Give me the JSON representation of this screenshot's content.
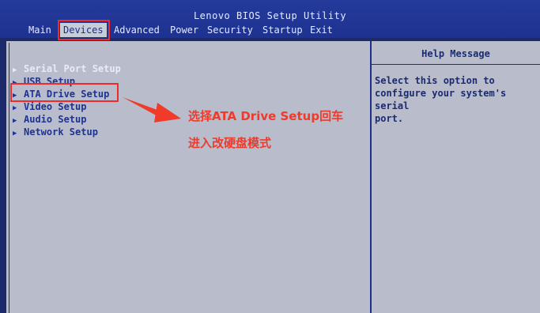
{
  "bios": {
    "title": "Lenovo BIOS Setup Utility",
    "tabs": [
      {
        "label": "Main"
      },
      {
        "label": "Devices"
      },
      {
        "label": "Advanced"
      },
      {
        "label": "Power"
      },
      {
        "label": "Security"
      },
      {
        "label": "Startup"
      },
      {
        "label": "Exit"
      }
    ],
    "menu": [
      {
        "label": "Serial Port Setup"
      },
      {
        "label": "USB Setup"
      },
      {
        "label": "ATA Drive Setup"
      },
      {
        "label": "Video Setup"
      },
      {
        "label": "Audio Setup"
      },
      {
        "label": "Network Setup"
      }
    ],
    "help": {
      "title": "Help Message",
      "text": "Select this option to\nconfigure your system's serial\nport."
    }
  },
  "annotation": {
    "line1": "选择ATA Drive Setup回车",
    "line2": "进入改硬盘模式"
  },
  "colors": {
    "highlight": "#ef2a2a",
    "annotation": "#f03a2a",
    "bios_blue": "#1e3290"
  }
}
